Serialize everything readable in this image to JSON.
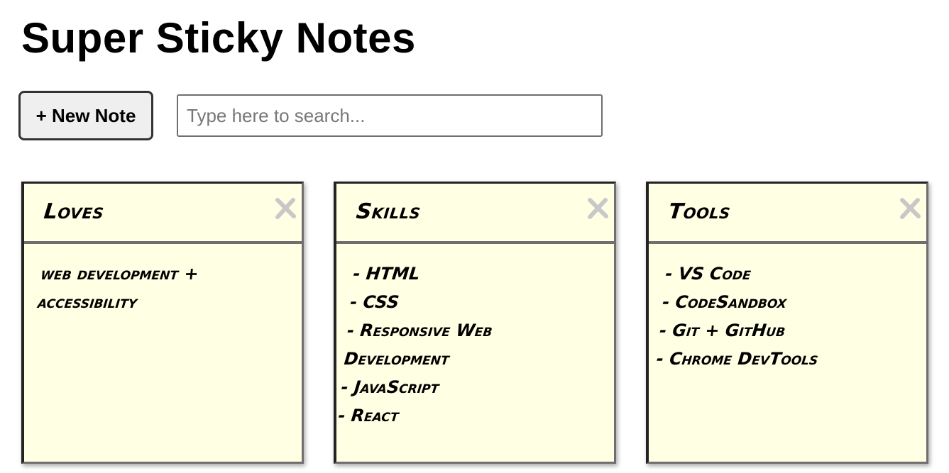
{
  "header": {
    "title": "Super Sticky Notes"
  },
  "toolbar": {
    "new_note_label": "+ New Note",
    "search_placeholder": "Type here to search...",
    "search_value": ""
  },
  "notes": [
    {
      "title": "Loves",
      "close_icon": "close-icon",
      "lines": [
        "web development +",
        "accessibility"
      ]
    },
    {
      "title": "Skills",
      "close_icon": "close-icon",
      "lines": [
        "- HTML",
        "- CSS",
        "- Responsive Web",
        "Development",
        "- JavaScript",
        "- React"
      ]
    },
    {
      "title": "Tools",
      "close_icon": "close-icon",
      "lines": [
        "- VS Code",
        "- CodeSandbox",
        "- Git + GitHub",
        "- Chrome DevTools"
      ]
    }
  ],
  "colors": {
    "note_background": "#ffffe3",
    "note_border": "#6f6f6f",
    "close_icon": "#c8c8c8",
    "button_background": "#efefef"
  }
}
